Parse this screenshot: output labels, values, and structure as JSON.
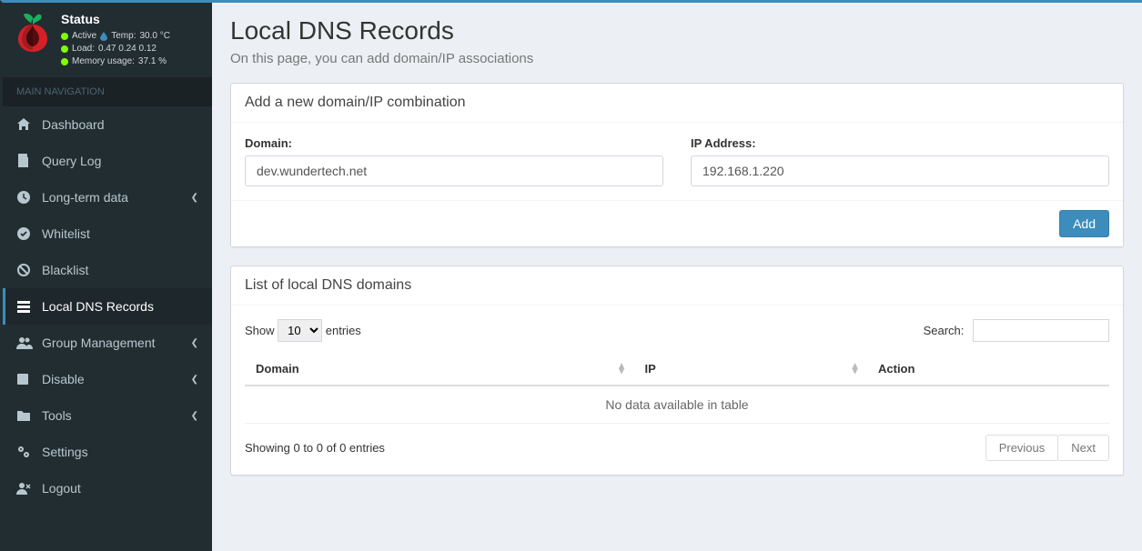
{
  "status": {
    "title": "Status",
    "active_label": "Active",
    "temp_label": "Temp:",
    "temp_value": "30.0 °C",
    "load_label": "Load:",
    "load_value": "0.47  0.24  0.12",
    "mem_label": "Memory usage:",
    "mem_value": "37.1 %"
  },
  "nav": {
    "header": "MAIN NAVIGATION",
    "items": [
      {
        "label": "Dashboard",
        "icon": "home",
        "caret": false
      },
      {
        "label": "Query Log",
        "icon": "file",
        "caret": false
      },
      {
        "label": "Long-term data",
        "icon": "clock",
        "caret": true
      },
      {
        "label": "Whitelist",
        "icon": "check-circle",
        "caret": false
      },
      {
        "label": "Blacklist",
        "icon": "ban",
        "caret": false
      },
      {
        "label": "Local DNS Records",
        "icon": "list",
        "caret": false
      },
      {
        "label": "Group Management",
        "icon": "users",
        "caret": true
      },
      {
        "label": "Disable",
        "icon": "stop",
        "caret": true
      },
      {
        "label": "Tools",
        "icon": "folder",
        "caret": true
      },
      {
        "label": "Settings",
        "icon": "cogs",
        "caret": false
      },
      {
        "label": "Logout",
        "icon": "user-x",
        "caret": false
      }
    ]
  },
  "page": {
    "title": "Local DNS Records",
    "subtitle": "On this page, you can add domain/IP associations"
  },
  "add_box": {
    "title": "Add a new domain/IP combination",
    "domain_label": "Domain:",
    "domain_value": "dev.wundertech.net",
    "ip_label": "IP Address:",
    "ip_value": "192.168.1.220",
    "add_button": "Add"
  },
  "list_box": {
    "title": "List of local DNS domains",
    "show_label": "Show",
    "entries_label": "entries",
    "length_value": "10",
    "search_label": "Search:",
    "columns": {
      "domain": "Domain",
      "ip": "IP",
      "action": "Action"
    },
    "empty": "No data available in table",
    "info": "Showing 0 to 0 of 0 entries",
    "prev": "Previous",
    "next": "Next"
  }
}
